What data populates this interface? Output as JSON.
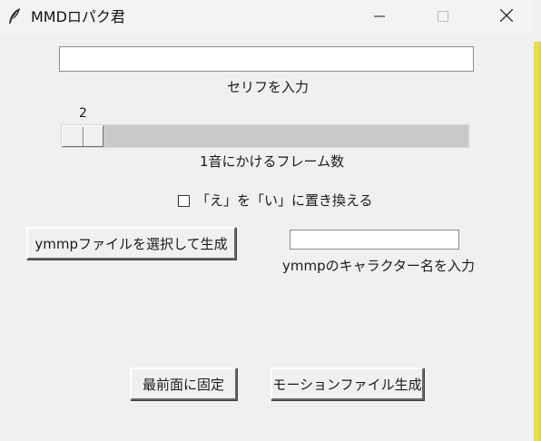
{
  "window": {
    "title": "MMDロパク君",
    "icon": "feather-icon",
    "controls": {
      "minimize": "minimize-icon",
      "maximize": "maximize-icon",
      "close": "close-icon"
    }
  },
  "serif_entry": {
    "value": "",
    "label": "セリフを入力"
  },
  "frames_scale": {
    "value": "2",
    "label": "1音にかけるフレーム数"
  },
  "replace_checkbox": {
    "checked": false,
    "label": "「え」を「い」に置き換える"
  },
  "ymmp_button": {
    "label": "ymmpファイルを選択して生成"
  },
  "character_entry": {
    "value": "",
    "label": "ymmpのキャラクター名を入力"
  },
  "bottom_buttons": {
    "topmost_label": "最前面に固定",
    "motion_label": "モーションファイル生成"
  }
}
